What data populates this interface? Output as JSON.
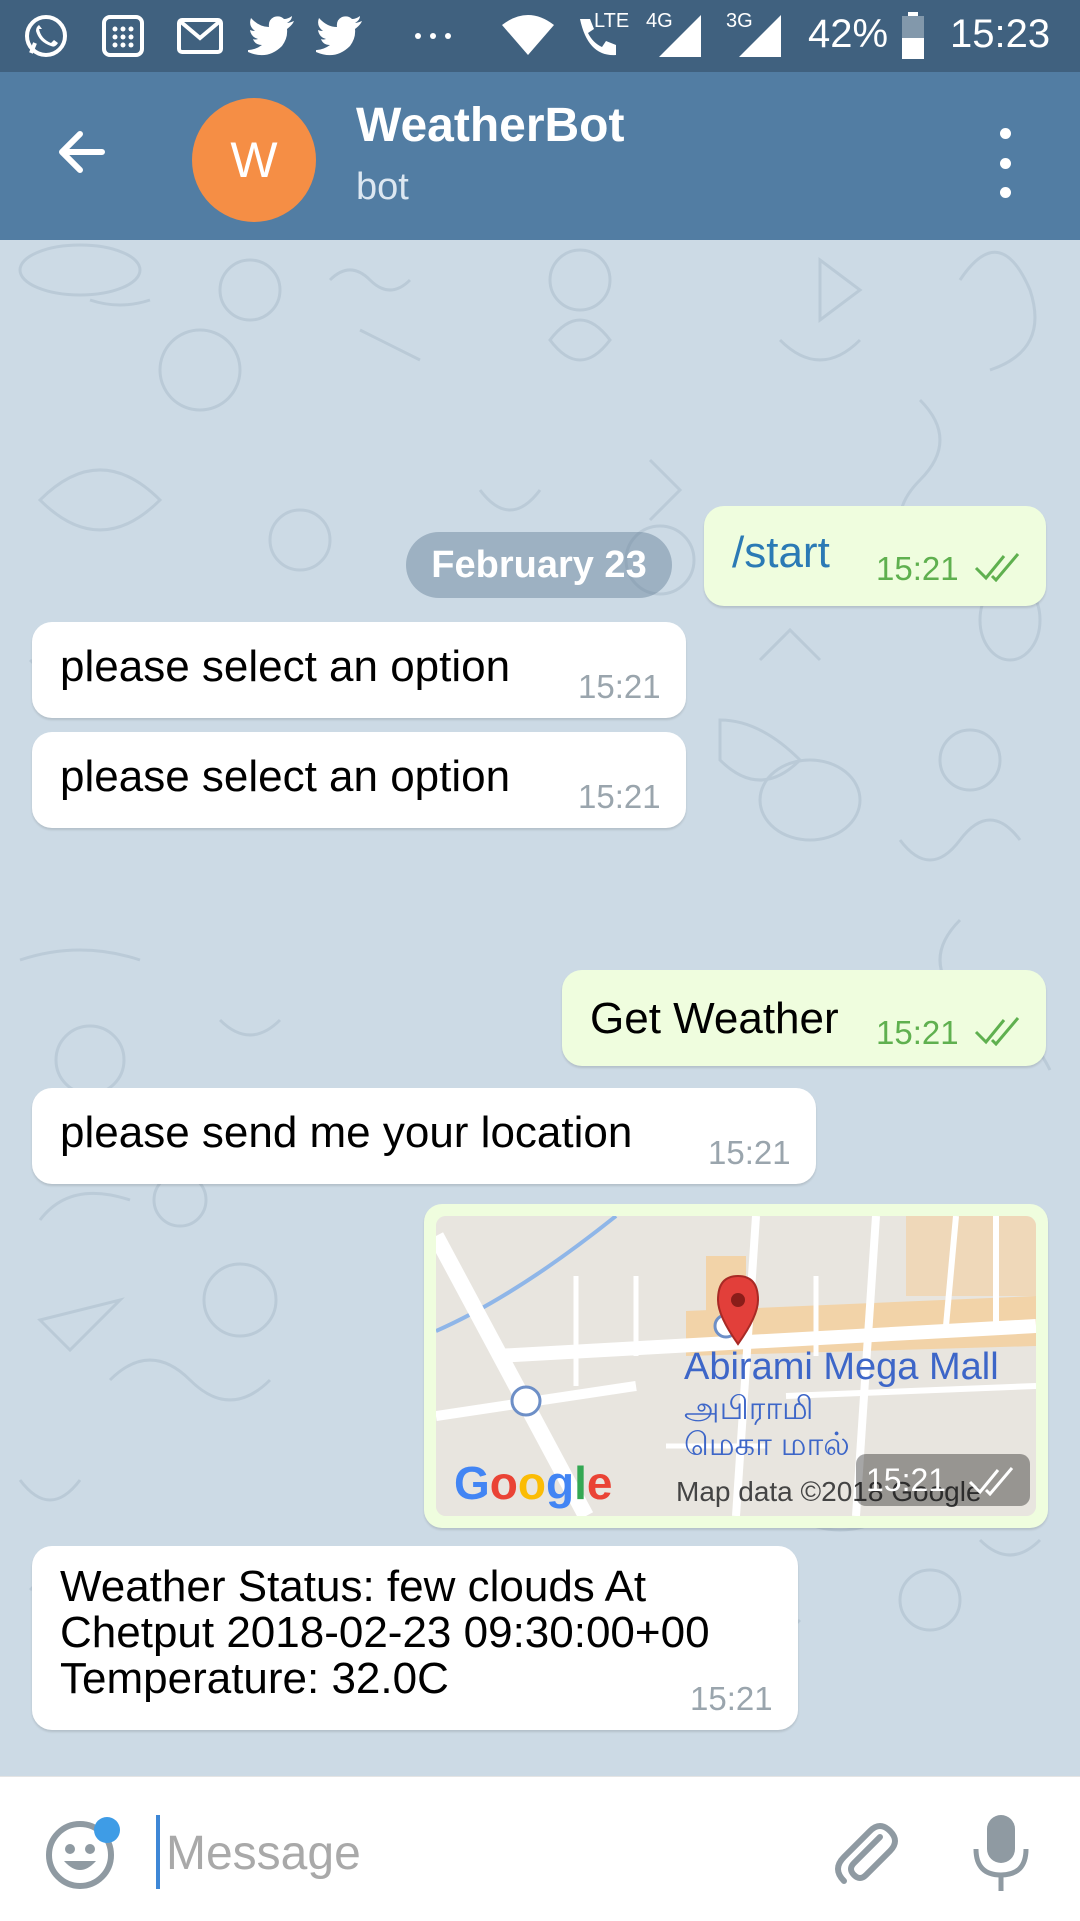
{
  "status_bar": {
    "network_lte": "LTE",
    "network_4g": "4G",
    "network_3g": "3G",
    "battery": "42%",
    "time": "15:23",
    "icons": [
      "whatsapp-icon",
      "calculator-icon",
      "gmail-icon",
      "twitter-icon",
      "twitter-icon",
      "more-icon",
      "wifi-icon",
      "call-icon",
      "signal-icon",
      "signal-icon",
      "battery-icon"
    ]
  },
  "header": {
    "avatar_letter": "W",
    "avatar_color": "#f58e45",
    "title": "WeatherBot",
    "subtitle": "bot"
  },
  "chat": {
    "date": "February 23",
    "messages": [
      {
        "side": "outgoing",
        "text": "/start",
        "time": "15:21"
      },
      {
        "side": "incoming",
        "text": "please select an option",
        "time": "15:21"
      },
      {
        "side": "incoming",
        "text": "please select an option",
        "time": "15:21"
      },
      {
        "side": "outgoing",
        "text": "Get Weather",
        "time": "15:21"
      },
      {
        "side": "incoming",
        "text": "please send me your location",
        "time": "15:21"
      },
      {
        "side": "outgoing",
        "type": "location",
        "time": "15:21"
      },
      {
        "side": "incoming",
        "lines": [
          "Weather Status: few clouds At",
          "Chetput 2018-02-23 09:30:00+00",
          "Temperature: 32.0C"
        ],
        "time": "15:21"
      }
    ],
    "map": {
      "place_name": "Abirami Mega Mall",
      "place_name_tamil_1": "அபிராமி",
      "place_name_tamil_2": "மெகா மால்",
      "credit": "Map data ©2018 Google",
      "logo": "Google"
    }
  },
  "input": {
    "placeholder": "Message"
  },
  "colors": {
    "status_bar": "#40617f",
    "app_bar": "#527da3",
    "outgoing_bubble": "#effdde",
    "incoming_bubble": "#ffffff",
    "chat_background": "#ccdae5"
  }
}
